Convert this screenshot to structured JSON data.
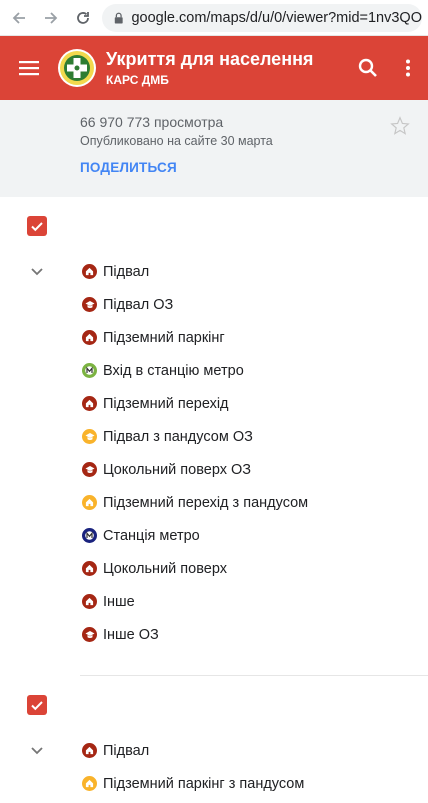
{
  "browser": {
    "url": "google.com/maps/d/u/0/viewer?mid=1nv3QO"
  },
  "header": {
    "title": "Укриття для населення",
    "owner": "КАРС ДМБ"
  },
  "info": {
    "views": "66 970 773 просмотра",
    "published": "Опубликовано на сайте 30 марта",
    "share": "ПОДЕЛИТЬСЯ"
  },
  "colors": {
    "red": "#db4437",
    "darkred": "#a52714",
    "yellow": "#f9b32b",
    "green": "#7cb342",
    "navy": "#1a237e",
    "link": "#4285f4"
  },
  "layers": [
    {
      "items": [
        {
          "label": "Підвал",
          "color": "#a52714",
          "icon": "home-icon"
        },
        {
          "label": "Підвал ОЗ",
          "color": "#a52714",
          "icon": "cap-icon"
        },
        {
          "label": "Підземний паркінг",
          "color": "#a52714",
          "icon": "home-icon"
        },
        {
          "label": "Вхід в станцію метро",
          "color": "#7cb342",
          "icon": "metro-icon"
        },
        {
          "label": "Підземний перехід",
          "color": "#a52714",
          "icon": "home-icon"
        },
        {
          "label": "Підвал з пандусом ОЗ",
          "color": "#f9b32b",
          "icon": "cap-icon"
        },
        {
          "label": "Цокольний поверх ОЗ",
          "color": "#a52714",
          "icon": "cap-icon"
        },
        {
          "label": "Підземний перехід з пандусом",
          "color": "#f9b32b",
          "icon": "home-icon"
        },
        {
          "label": "Станція метро",
          "color": "#1a237e",
          "icon": "metro-icon"
        },
        {
          "label": "Цокольний поверх",
          "color": "#a52714",
          "icon": "home-icon"
        },
        {
          "label": "Інше",
          "color": "#a52714",
          "icon": "home-icon"
        },
        {
          "label": "Інше ОЗ",
          "color": "#a52714",
          "icon": "cap-icon"
        }
      ]
    },
    {
      "items": [
        {
          "label": "Підвал",
          "color": "#a52714",
          "icon": "home-icon"
        },
        {
          "label": "Підземний паркінг з пандусом",
          "color": "#f9b32b",
          "icon": "home-icon"
        }
      ]
    }
  ]
}
